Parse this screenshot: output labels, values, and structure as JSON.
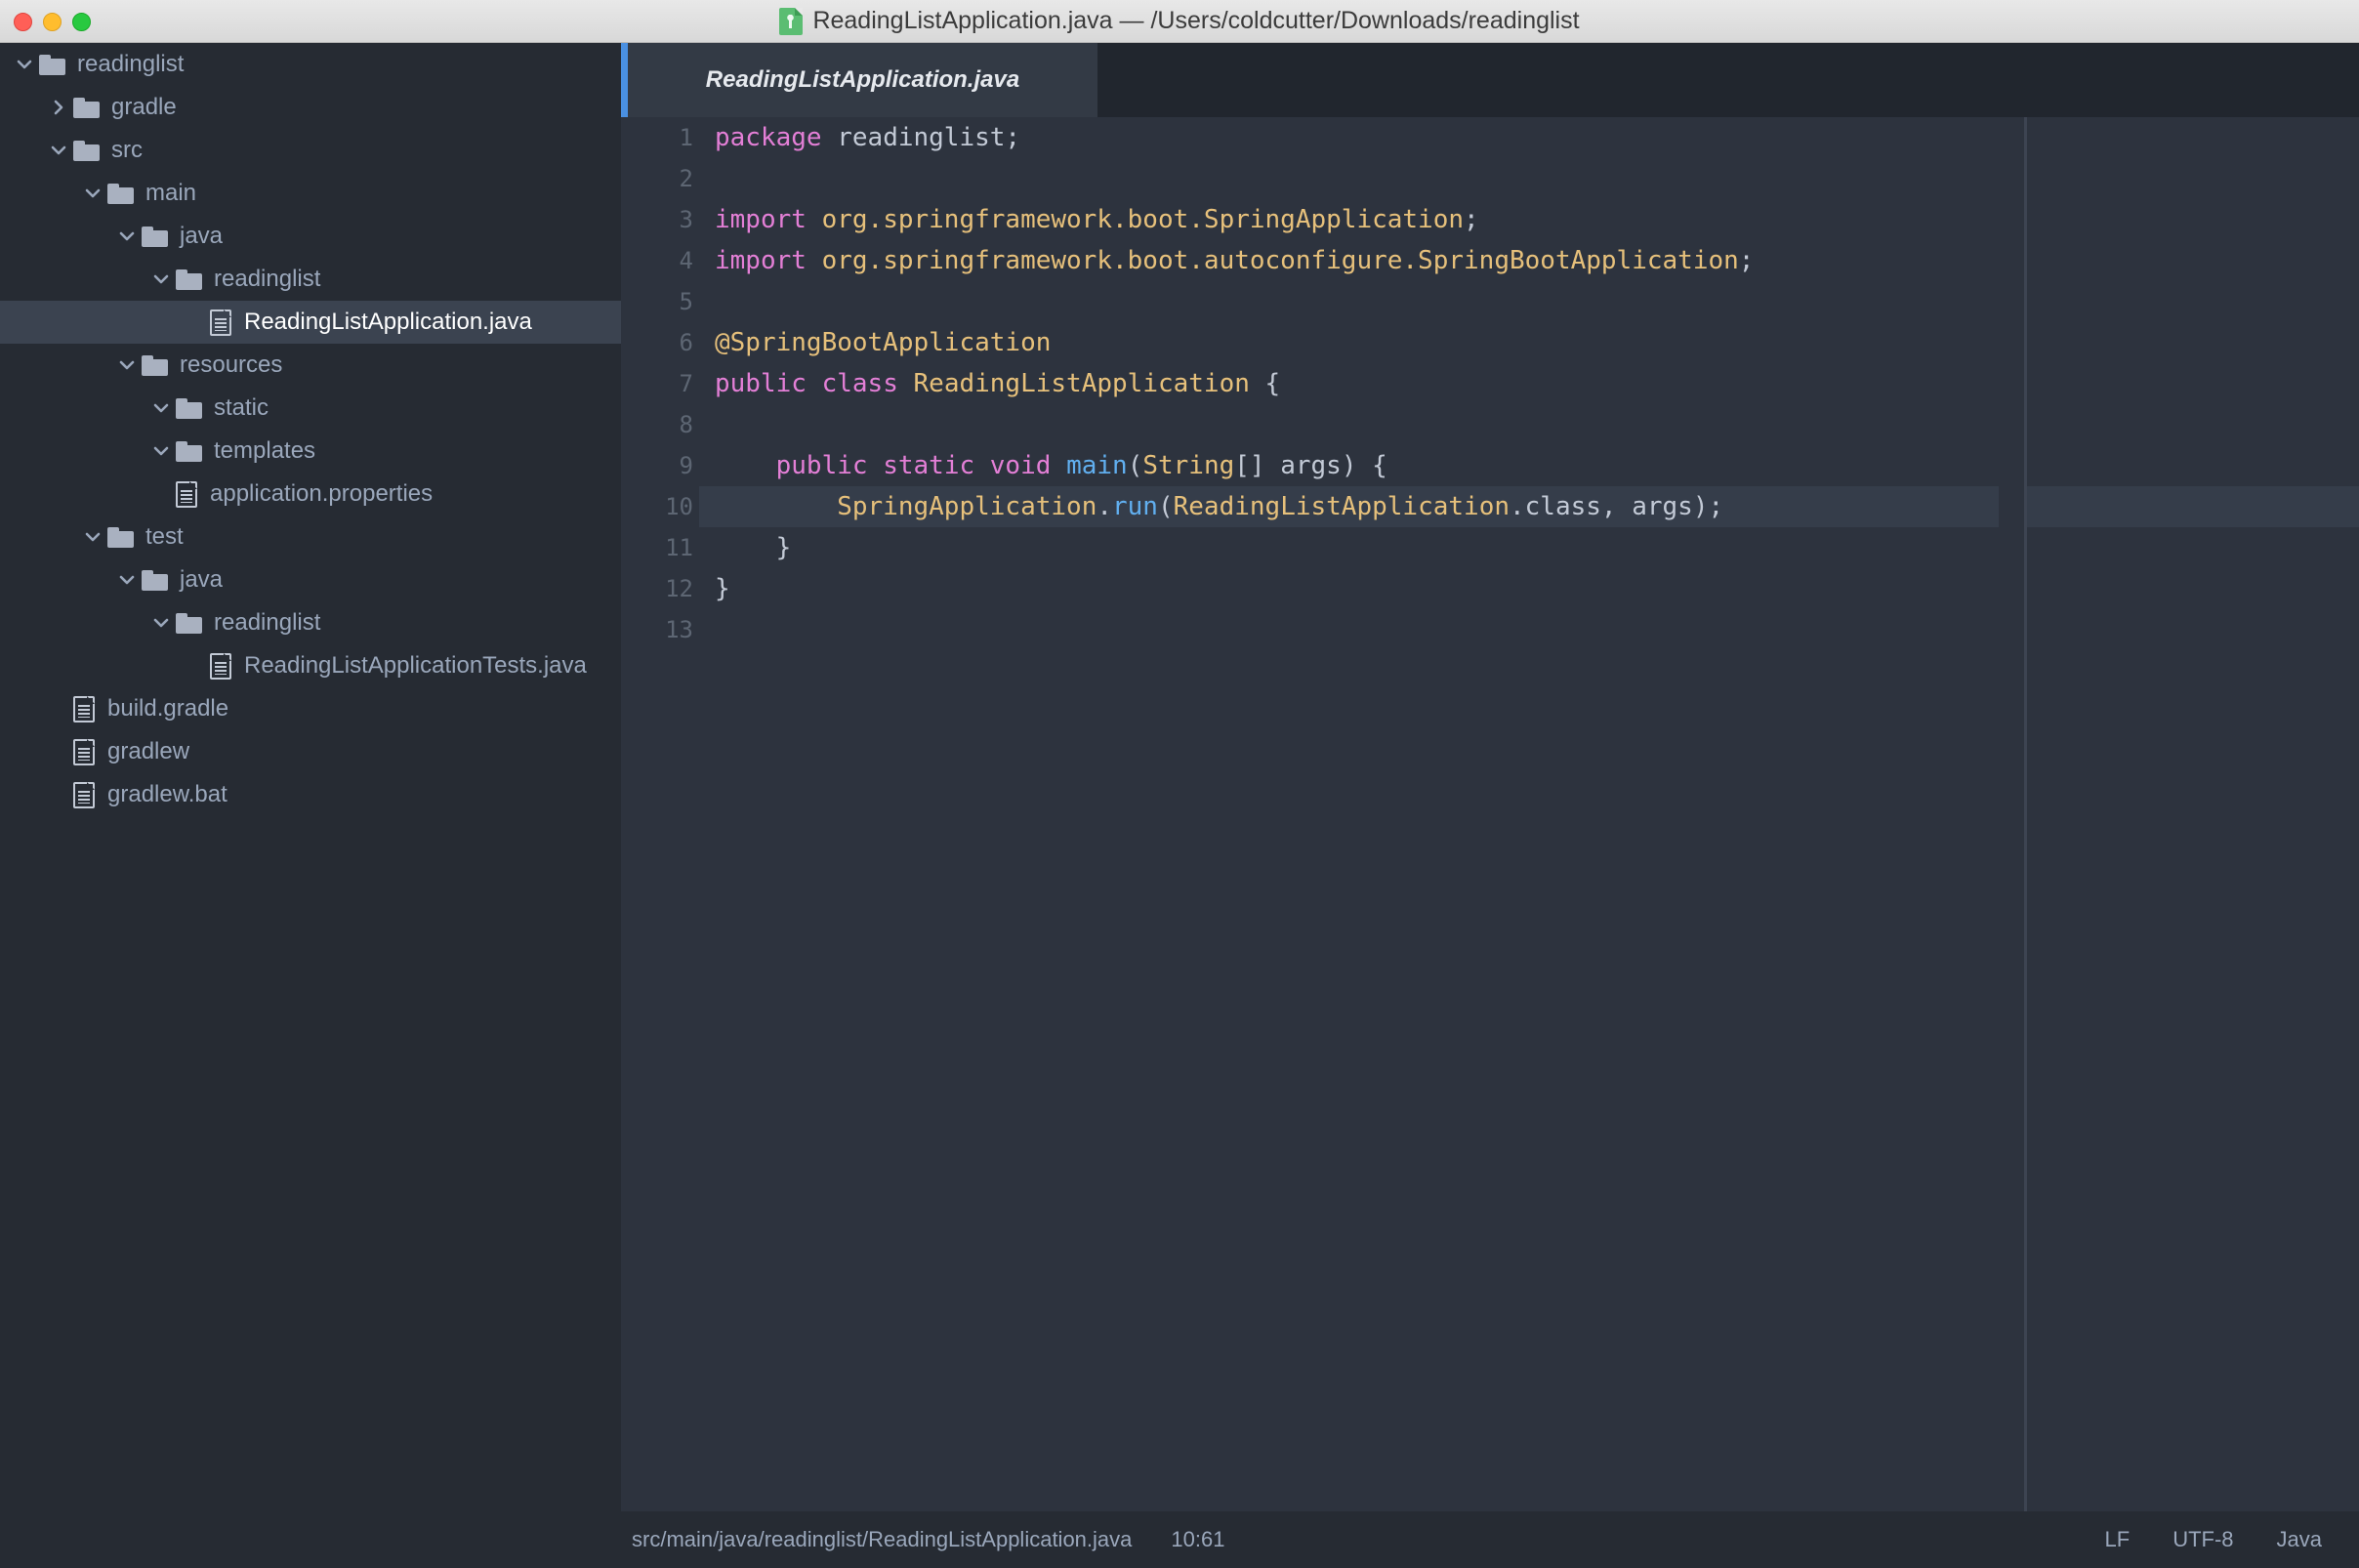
{
  "window": {
    "title": "ReadingListApplication.java — /Users/coldcutter/Downloads/readinglist",
    "traffic_lights": [
      "close",
      "minimize",
      "zoom"
    ],
    "title_icon": "java-file-icon",
    "colors": {
      "accent": "#4a90e2",
      "editor_bg": "#2d333e",
      "sidebar_bg": "#262b33",
      "titlebar_bg": "#e8e8e8"
    }
  },
  "sidebar": {
    "items": [
      {
        "label": "readinglist",
        "depth": 0,
        "type": "folder",
        "chevron": "down",
        "selected": false
      },
      {
        "label": "gradle",
        "depth": 1,
        "type": "folder",
        "chevron": "right",
        "selected": false
      },
      {
        "label": "src",
        "depth": 1,
        "type": "folder",
        "chevron": "down",
        "selected": false
      },
      {
        "label": "main",
        "depth": 2,
        "type": "folder",
        "chevron": "down",
        "selected": false
      },
      {
        "label": "java",
        "depth": 3,
        "type": "folder",
        "chevron": "down",
        "selected": false
      },
      {
        "label": "readinglist",
        "depth": 4,
        "type": "folder",
        "chevron": "down",
        "selected": false
      },
      {
        "label": "ReadingListApplication.java",
        "depth": 5,
        "type": "file",
        "chevron": "none",
        "selected": true
      },
      {
        "label": "resources",
        "depth": 3,
        "type": "folder",
        "chevron": "down",
        "selected": false
      },
      {
        "label": "static",
        "depth": 4,
        "type": "folder",
        "chevron": "down",
        "selected": false
      },
      {
        "label": "templates",
        "depth": 4,
        "type": "folder",
        "chevron": "down",
        "selected": false
      },
      {
        "label": "application.properties",
        "depth": 4,
        "type": "file",
        "chevron": "none",
        "selected": false
      },
      {
        "label": "test",
        "depth": 2,
        "type": "folder",
        "chevron": "down",
        "selected": false
      },
      {
        "label": "java",
        "depth": 3,
        "type": "folder",
        "chevron": "down",
        "selected": false
      },
      {
        "label": "readinglist",
        "depth": 4,
        "type": "folder",
        "chevron": "down",
        "selected": false
      },
      {
        "label": "ReadingListApplicationTests.java",
        "depth": 5,
        "type": "file",
        "chevron": "none",
        "selected": false
      },
      {
        "label": "build.gradle",
        "depth": 1,
        "type": "file",
        "chevron": "none",
        "selected": false
      },
      {
        "label": "gradlew",
        "depth": 1,
        "type": "file",
        "chevron": "none",
        "selected": false
      },
      {
        "label": "gradlew.bat",
        "depth": 1,
        "type": "file",
        "chevron": "none",
        "selected": false
      }
    ]
  },
  "editor": {
    "tabs": [
      {
        "label": "ReadingListApplication.java",
        "active": true
      }
    ],
    "current_line": 10,
    "line_numbers": [
      "1",
      "2",
      "3",
      "4",
      "5",
      "6",
      "7",
      "8",
      "9",
      "10",
      "11",
      "12",
      "13"
    ],
    "lines": [
      {
        "n": 1,
        "tokens": [
          {
            "t": "package",
            "c": "kw"
          },
          {
            "t": " readinglist;",
            "c": "pl"
          }
        ]
      },
      {
        "n": 2,
        "tokens": []
      },
      {
        "n": 3,
        "tokens": [
          {
            "t": "import",
            "c": "kw"
          },
          {
            "t": " ",
            "c": "pl"
          },
          {
            "t": "org.springframework.boot.SpringApplication",
            "c": "id"
          },
          {
            "t": ";",
            "c": "pl"
          }
        ]
      },
      {
        "n": 4,
        "tokens": [
          {
            "t": "import",
            "c": "kw"
          },
          {
            "t": " ",
            "c": "pl"
          },
          {
            "t": "org.springframework.boot.autoconfigure.SpringBootApplication",
            "c": "id"
          },
          {
            "t": ";",
            "c": "pl"
          }
        ]
      },
      {
        "n": 5,
        "tokens": []
      },
      {
        "n": 6,
        "tokens": [
          {
            "t": "@SpringBootApplication",
            "c": "an"
          }
        ]
      },
      {
        "n": 7,
        "tokens": [
          {
            "t": "public",
            "c": "kw"
          },
          {
            "t": " ",
            "c": "pl"
          },
          {
            "t": "class",
            "c": "kw"
          },
          {
            "t": " ",
            "c": "pl"
          },
          {
            "t": "ReadingListApplication",
            "c": "id"
          },
          {
            "t": " {",
            "c": "pl"
          }
        ]
      },
      {
        "n": 8,
        "tokens": []
      },
      {
        "n": 9,
        "tokens": [
          {
            "t": "    ",
            "c": "pl"
          },
          {
            "t": "public",
            "c": "kw"
          },
          {
            "t": " ",
            "c": "pl"
          },
          {
            "t": "static",
            "c": "kw"
          },
          {
            "t": " ",
            "c": "pl"
          },
          {
            "t": "void",
            "c": "kw"
          },
          {
            "t": " ",
            "c": "pl"
          },
          {
            "t": "main",
            "c": "fn"
          },
          {
            "t": "(",
            "c": "pl"
          },
          {
            "t": "String",
            "c": "id"
          },
          {
            "t": "[] args) {",
            "c": "pl"
          }
        ]
      },
      {
        "n": 10,
        "tokens": [
          {
            "t": "        ",
            "c": "pl"
          },
          {
            "t": "SpringApplication",
            "c": "id"
          },
          {
            "t": ".",
            "c": "pl"
          },
          {
            "t": "run",
            "c": "fn"
          },
          {
            "t": "(",
            "c": "pl"
          },
          {
            "t": "ReadingListApplication",
            "c": "id"
          },
          {
            "t": ".class, args);",
            "c": "pl"
          }
        ]
      },
      {
        "n": 11,
        "tokens": [
          {
            "t": "    }",
            "c": "pl"
          }
        ]
      },
      {
        "n": 12,
        "tokens": [
          {
            "t": "}",
            "c": "pl"
          }
        ]
      },
      {
        "n": 13,
        "tokens": []
      }
    ]
  },
  "statusbar": {
    "file_path": "src/main/java/readinglist/ReadingListApplication.java",
    "cursor_position": "10:61",
    "line_ending": "LF",
    "encoding": "UTF-8",
    "language": "Java"
  }
}
